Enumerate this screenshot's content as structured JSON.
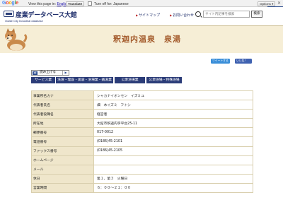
{
  "translate_bar": {
    "view_text": "View this page in:",
    "language": "English",
    "translate_label": "Translate",
    "turn_off_text": "Turn off for: Japanese",
    "options_label": "Options ▾",
    "close_label": "✕"
  },
  "header": {
    "logo_jp": "産業データベース大館",
    "logo_en": "Odate City Industrial database",
    "sitemap_label": "サイトマップ",
    "contact_label": "お問い合わせ",
    "search_placeholder": "サイト内記事を検索",
    "search_button": "検索"
  },
  "banner": {
    "title": "釈迦内温泉　泉湯"
  },
  "share": {
    "tweet_label": "ツイートする",
    "like_label": "いいね！"
  },
  "read_aloud": {
    "label": "読み上げる"
  },
  "categories": [
    "サービス業",
    "洗濯・理容・美容・浴場業・銭湯業",
    "公衆浴場業",
    "公衆浴場・特殊浴場"
  ],
  "details": [
    {
      "label": "事業所名カナ",
      "value": "シャカナイオンセン　イズミユ"
    },
    {
      "label": "代表者氏名",
      "value": "畑　木イズミ　フトシ"
    },
    {
      "label": "代表者役職名",
      "value": "経営者"
    },
    {
      "label": "所在地",
      "value": "大館市釈迦内字平台25-11"
    },
    {
      "label": "郵便番号",
      "value": "017-0012"
    },
    {
      "label": "電話番号",
      "value": "(0186)45-2101"
    },
    {
      "label": "ファックス番号",
      "value": "(0186)45-2105"
    },
    {
      "label": "ホームページ",
      "value": ""
    },
    {
      "label": "メール",
      "value": ""
    },
    {
      "label": "休日",
      "value": "第１、第３　火曜日"
    },
    {
      "label": "営業時間",
      "value": "６：００～２１：００"
    }
  ],
  "colors": {
    "navy": "#2b3c78",
    "banner_bg": "#f6eed6",
    "title_brown": "#a35a2b",
    "label_bg": "#efe6cb"
  }
}
